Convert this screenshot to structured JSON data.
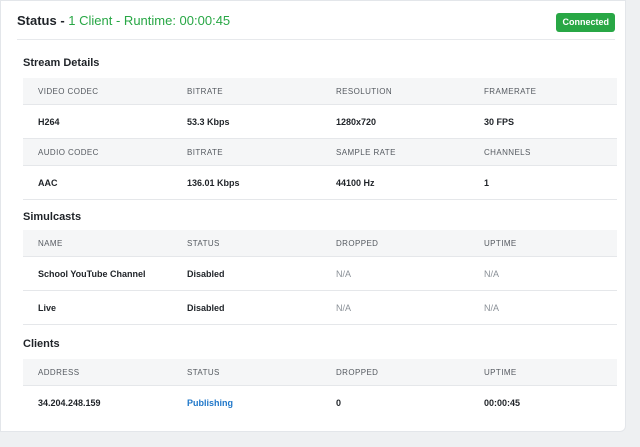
{
  "header": {
    "status_label": "Status",
    "separator": " - ",
    "summary": "1 Client - Runtime: 00:00:45",
    "connection_badge": "Connected"
  },
  "colors": {
    "accent_green": "#28a745",
    "link_blue": "#1f77c9"
  },
  "stream_details": {
    "title": "Stream Details",
    "video": {
      "headers": [
        "VIDEO CODEC",
        "BITRATE",
        "RESOLUTION",
        "FRAMERATE"
      ],
      "values": [
        "H264",
        "53.3 Kbps",
        "1280x720",
        "30 FPS"
      ]
    },
    "audio": {
      "headers": [
        "AUDIO CODEC",
        "BITRATE",
        "SAMPLE RATE",
        "CHANNELS"
      ],
      "values": [
        "AAC",
        "136.01 Kbps",
        "44100 Hz",
        "1"
      ]
    }
  },
  "simulcasts": {
    "title": "Simulcasts",
    "headers": [
      "NAME",
      "STATUS",
      "DROPPED",
      "UPTIME"
    ],
    "rows": [
      [
        "School YouTube Channel",
        "Disabled",
        "N/A",
        "N/A"
      ],
      [
        "Live",
        "Disabled",
        "N/A",
        "N/A"
      ]
    ]
  },
  "clients": {
    "title": "Clients",
    "headers": [
      "ADDRESS",
      "STATUS",
      "DROPPED",
      "UPTIME"
    ],
    "rows": [
      [
        "34.204.248.159",
        "Publishing",
        "0",
        "00:00:45"
      ]
    ]
  }
}
